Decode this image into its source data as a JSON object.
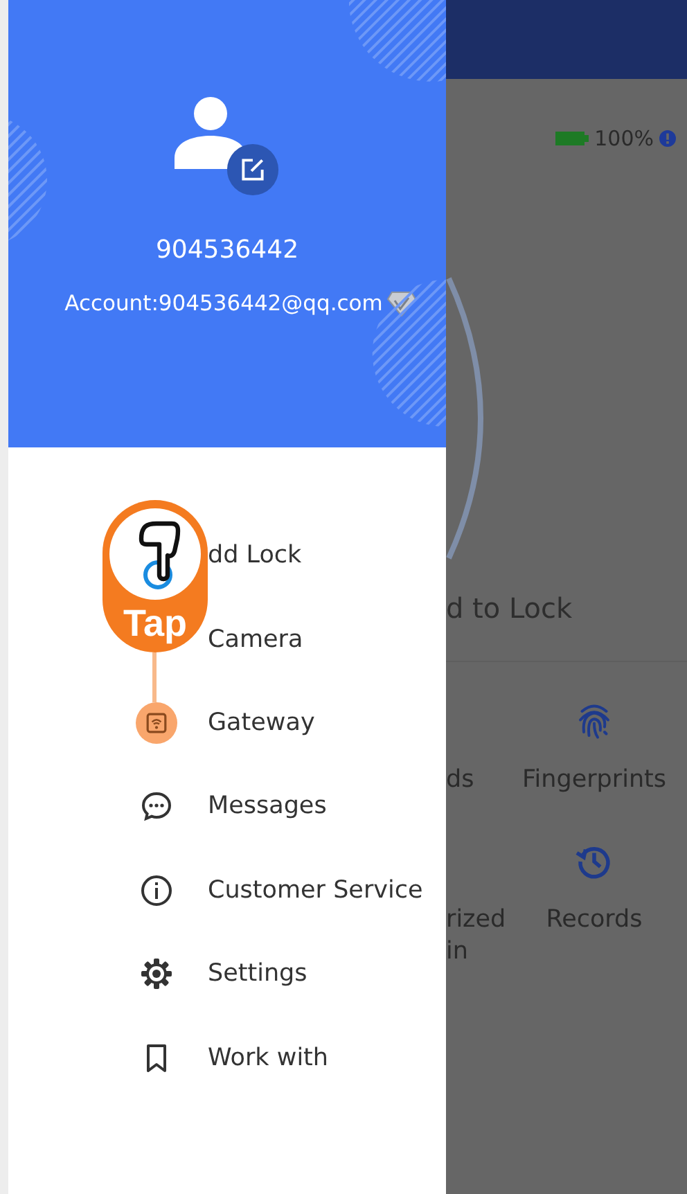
{
  "background_screen": {
    "battery": "100%",
    "lock_hint": "d to Lock",
    "grid": [
      {
        "label": "ds",
        "kind": "none"
      },
      {
        "label": "Fingerprints",
        "kind": "fingerprint"
      },
      {
        "label": "rized\nin",
        "kind": "none"
      },
      {
        "label": "Records",
        "kind": "history"
      }
    ]
  },
  "drawer": {
    "username": "904536442",
    "account": "Account:904536442@qq.com",
    "menu": [
      {
        "label": "dd Lock",
        "kind": "lock",
        "highlighted": false
      },
      {
        "label": "Camera",
        "kind": "camera",
        "highlighted": false
      },
      {
        "label": "Gateway",
        "kind": "gateway",
        "highlighted": true
      },
      {
        "label": "Messages",
        "kind": "messages",
        "highlighted": false
      },
      {
        "label": "Customer Service",
        "kind": "info",
        "highlighted": false
      },
      {
        "label": "Settings",
        "kind": "settings",
        "highlighted": false
      },
      {
        "label": "Work with",
        "kind": "bookmark",
        "highlighted": false
      }
    ]
  },
  "tap_hint": {
    "label": "Tap"
  }
}
